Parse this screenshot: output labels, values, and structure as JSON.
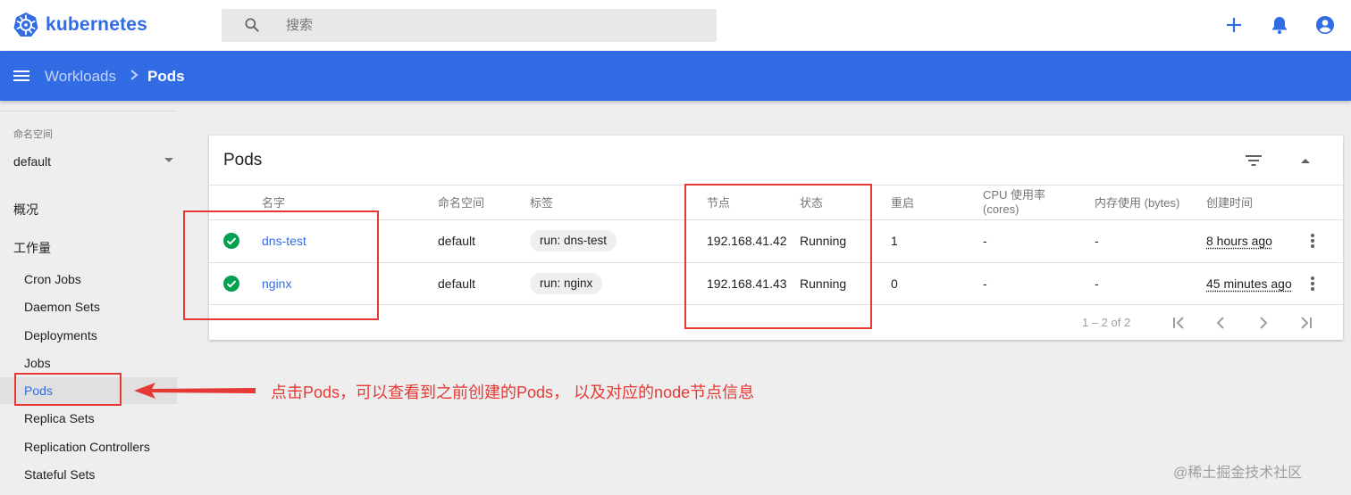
{
  "brand": {
    "name": "kubernetes"
  },
  "search": {
    "placeholder": "搜索"
  },
  "topbar_icons": [
    "add-icon",
    "notifications-icon",
    "account-circle-icon"
  ],
  "breadcrumb": {
    "parent": "Workloads",
    "current": "Pods"
  },
  "sidebar": {
    "namespace_label": "命名空间",
    "namespace_value": "default",
    "overview": "概况",
    "workloads": "工作量",
    "items": [
      {
        "label": "Cron Jobs"
      },
      {
        "label": "Daemon Sets"
      },
      {
        "label": "Deployments"
      },
      {
        "label": "Jobs"
      },
      {
        "label": "Pods",
        "active": true
      },
      {
        "label": "Replica Sets"
      },
      {
        "label": "Replication Controllers"
      },
      {
        "label": "Stateful Sets"
      }
    ]
  },
  "pods_card": {
    "title": "Pods",
    "columns": {
      "name": "名字",
      "namespace": "命名空间",
      "labels": "标签",
      "node": "节点",
      "status": "状态",
      "restarts": "重启",
      "cpu_line1": "CPU 使用率",
      "cpu_line2": "(cores)",
      "memory": "内存使用 (bytes)",
      "created": "创建时间"
    },
    "rows": [
      {
        "name": "dns-test",
        "namespace": "default",
        "label": "run: dns-test",
        "node": "192.168.41.42",
        "status": "Running",
        "restarts": "1",
        "cpu": "-",
        "memory": "-",
        "created": "8 hours ago"
      },
      {
        "name": "nginx",
        "namespace": "default",
        "label": "run: nginx",
        "node": "192.168.41.43",
        "status": "Running",
        "restarts": "0",
        "cpu": "-",
        "memory": "-",
        "created": "45 minutes ago"
      }
    ],
    "pagination": {
      "range": "1 – 2 of 2"
    }
  },
  "annotation": {
    "text": "点击Pods，可以查看到之前创建的Pods， 以及对应的node节点信息",
    "color": "#e53935"
  },
  "watermark": "@稀土掘金技术社区",
  "colors": {
    "brand": "#326ce5",
    "success": "#00a152",
    "annotation": "#e53935"
  }
}
